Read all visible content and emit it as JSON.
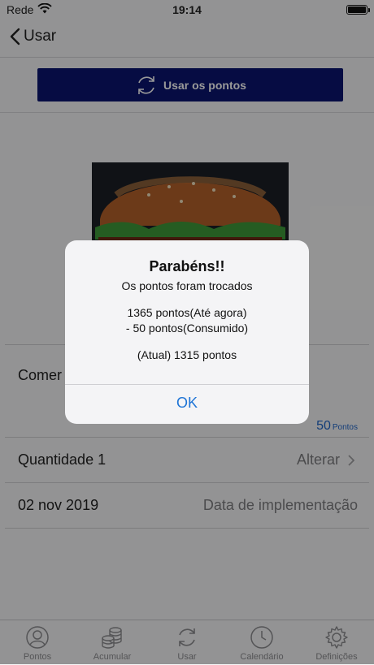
{
  "status_bar": {
    "carrier": "Rede",
    "time": "19:14"
  },
  "nav": {
    "back_label": "Usar"
  },
  "use_button": {
    "label": "Usar os pontos"
  },
  "product": {
    "name_partial": "Comer"
  },
  "points": {
    "value": "50",
    "unit": "Pontos"
  },
  "quantity": {
    "label": "Quantidade 1",
    "action": "Alterar"
  },
  "date": {
    "value": "02 nov 2019",
    "caption": "Data de implementação"
  },
  "alert": {
    "title": "Parabéns!!",
    "subtitle": "Os pontos foram trocados",
    "line_before": "1365 pontos(Até agora)",
    "line_consumed": "- 50 pontos(Consumido)",
    "line_current": "(Atual) 1315 pontos",
    "ok_label": "OK"
  },
  "tabs": [
    {
      "label": "Pontos",
      "icon": "person-circle-icon"
    },
    {
      "label": "Acumular",
      "icon": "coins-stack-icon"
    },
    {
      "label": "Usar",
      "icon": "refresh-icon"
    },
    {
      "label": "Calendário",
      "icon": "clock-icon"
    },
    {
      "label": "Definições",
      "icon": "gear-icon"
    }
  ],
  "colors": {
    "primary_button": "#0a1570",
    "link": "#1e74d6",
    "points_blue": "#1e64c8"
  }
}
